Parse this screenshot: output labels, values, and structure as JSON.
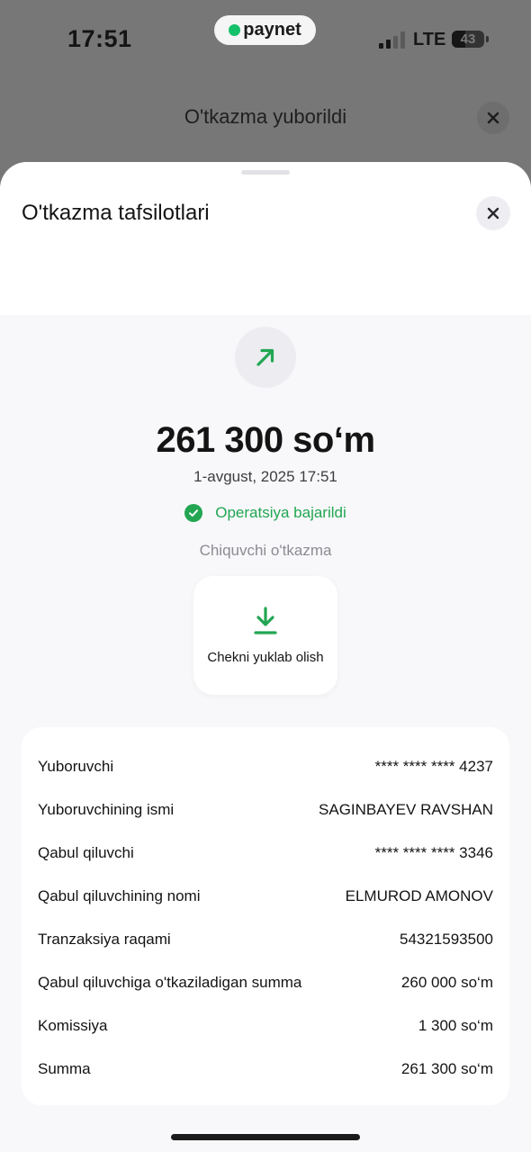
{
  "status_bar": {
    "time": "17:51",
    "carrier": "paynet",
    "network": "LTE",
    "battery": "43",
    "battery_fraction": 0.43
  },
  "background_screen": {
    "title": "O'tkazma yuborildi"
  },
  "sheet": {
    "title": "O'tkazma tafsilotlari",
    "amount": "261 300 so‘m",
    "date": "1-avgust, 2025 17:51",
    "status": "Operatsiya bajarildi",
    "direction": "Chiquvchi o'tkazma",
    "download_label": "Chekni yuklab olish"
  },
  "details": [
    {
      "label": "Yuboruvchi",
      "value": "**** **** **** 4237"
    },
    {
      "label": "Yuboruvchining ismi",
      "value": "SAGINBAYEV RAVSHAN"
    },
    {
      "label": "Qabul qiluvchi",
      "value": "**** **** **** 3346"
    },
    {
      "label": "Qabul qiluvchining nomi",
      "value": "ELMUROD AMONOV"
    },
    {
      "label": "Tranzaksiya raqami",
      "value": "54321593500"
    },
    {
      "label": "Qabul qiluvchiga o'tkaziladigan summa",
      "value": "260 000 so‘m"
    },
    {
      "label": "Komissiya",
      "value": "1 300 so‘m"
    },
    {
      "label": "Summa",
      "value": "261 300 so‘m"
    }
  ],
  "colors": {
    "success": "#22a652",
    "overlay": "#777777",
    "sheet_background": "#f8f8fa"
  },
  "icons": {
    "close": "close-icon",
    "outgoing": "arrow-up-right-icon",
    "status": "check-circle-icon",
    "download": "download-icon"
  }
}
